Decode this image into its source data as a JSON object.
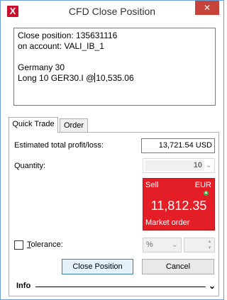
{
  "window": {
    "title": "CFD Close Position",
    "app_icon": "X",
    "close_label": "✕"
  },
  "summary": {
    "line1": "Close position: 135631116",
    "line2": "on account: VALI_IB_1",
    "line3": "",
    "line4": "Germany 30",
    "line5_before_caret": "Long 10 GER30.I @",
    "line5_after_caret": "10,535.06"
  },
  "tabs": [
    {
      "label": "Quick Trade",
      "active": true
    },
    {
      "label": "Order",
      "active": false
    }
  ],
  "quick_trade": {
    "pnl_label": "Estimated total profit/loss:",
    "pnl_value": "13,721.54 USD",
    "quantity_label": "Quantity:",
    "quantity_value": "10",
    "trade_button": {
      "side": "Sell",
      "currency": "EUR",
      "price": "11,812.35",
      "order_type": "Market order",
      "color": "#e41e26"
    },
    "tolerance_label_prefix": "",
    "tolerance_label_underlined": "T",
    "tolerance_label_rest": "olerance:",
    "tolerance_unit": "%",
    "close_position_label": "Close Position",
    "cancel_label": "Cancel",
    "info_label": "Info"
  },
  "icons": {
    "app": "cfd-app-icon",
    "close": "close-icon",
    "chevron": "chevron-down-icon",
    "up_arrow": "up-arrow-icon"
  }
}
